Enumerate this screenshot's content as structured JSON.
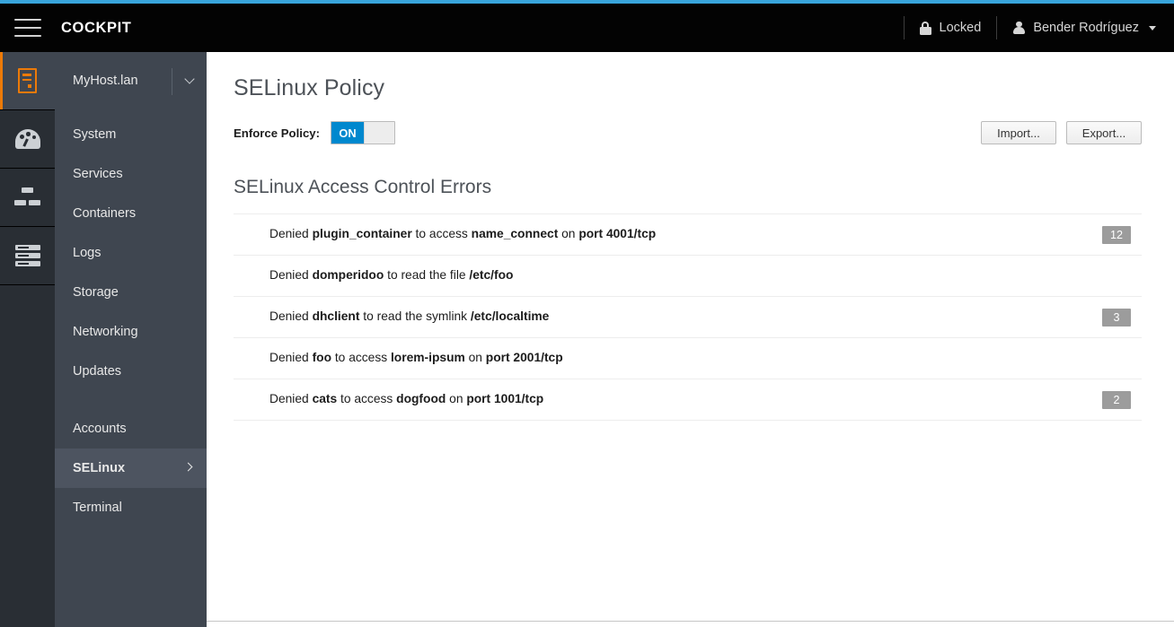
{
  "header": {
    "brand": "COCKPIT",
    "menu_icon": "hamburger-icon",
    "locked_label": "Locked",
    "user_label": "Bender Rodríguez"
  },
  "icon_rail": {
    "items": [
      {
        "icon": "server-tower-icon",
        "active": true
      },
      {
        "icon": "dashboard-gauge-icon",
        "active": false
      },
      {
        "icon": "cluster-icon",
        "active": false
      },
      {
        "icon": "rack-server-icon",
        "active": false
      }
    ]
  },
  "sidebar": {
    "host": "MyHost.lan",
    "group_primary": [
      {
        "label": "System"
      },
      {
        "label": "Services"
      },
      {
        "label": "Containers"
      },
      {
        "label": "Logs"
      },
      {
        "label": "Storage"
      },
      {
        "label": "Networking"
      },
      {
        "label": "Updates"
      }
    ],
    "group_secondary": [
      {
        "label": "Accounts",
        "active": false
      },
      {
        "label": "SELinux",
        "active": true
      },
      {
        "label": "Terminal",
        "active": false
      }
    ]
  },
  "main": {
    "page_title": "SELinux Policy",
    "enforce_label": "Enforce Policy:",
    "toggle_on_label": "ON",
    "toggle_state": "on",
    "import_label": "Import...",
    "export_label": "Export...",
    "section_title": "SELinux Access Control Errors",
    "errors": [
      {
        "parts": [
          {
            "t": "Denied ",
            "b": false
          },
          {
            "t": "plugin_container",
            "b": true
          },
          {
            "t": " to access ",
            "b": false
          },
          {
            "t": "name_connect",
            "b": true
          },
          {
            "t": " on ",
            "b": false
          },
          {
            "t": "port 4001/tcp",
            "b": true
          }
        ],
        "count": "12"
      },
      {
        "parts": [
          {
            "t": "Denied ",
            "b": false
          },
          {
            "t": "domperidoo",
            "b": true
          },
          {
            "t": " to read the file ",
            "b": false
          },
          {
            "t": "/etc/foo",
            "b": true
          }
        ],
        "count": ""
      },
      {
        "parts": [
          {
            "t": "Denied ",
            "b": false
          },
          {
            "t": "dhclient",
            "b": true
          },
          {
            "t": " to read the symlink ",
            "b": false
          },
          {
            "t": "/etc/localtime",
            "b": true
          }
        ],
        "count": "3"
      },
      {
        "parts": [
          {
            "t": "Denied ",
            "b": false
          },
          {
            "t": "foo",
            "b": true
          },
          {
            "t": " to access ",
            "b": false
          },
          {
            "t": "lorem-ipsum",
            "b": true
          },
          {
            "t": " on ",
            "b": false
          },
          {
            "t": "port 2001/tcp",
            "b": true
          }
        ],
        "count": ""
      },
      {
        "parts": [
          {
            "t": "Denied ",
            "b": false
          },
          {
            "t": "cats",
            "b": true
          },
          {
            "t": " to access ",
            "b": false
          },
          {
            "t": "dogfood",
            "b": true
          },
          {
            "t": " on ",
            "b": false
          },
          {
            "t": "port 1001/tcp",
            "b": true
          }
        ],
        "count": "2"
      }
    ]
  },
  "colors": {
    "accent_blue": "#39a5dc",
    "toggle_blue": "#0088ce",
    "active_orange": "#ec7a08",
    "header_black": "#030303",
    "rail_bg": "#292e34",
    "nav_bg": "#3f4650",
    "badge_gray": "#9c9c9c"
  }
}
